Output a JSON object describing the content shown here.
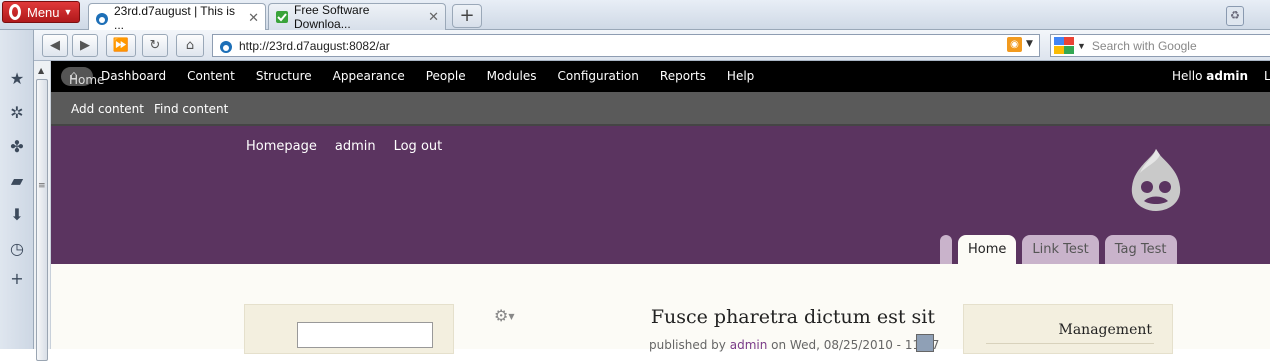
{
  "browser": {
    "menu_label": "Menu",
    "tabs": [
      {
        "title": "23rd.d7august | This is ...",
        "active": true
      },
      {
        "title": "Free Software Downloa...",
        "active": false
      }
    ],
    "url": "http://23rd.d7august:8082/ar",
    "search_placeholder": "Search with Google"
  },
  "toolbar": {
    "home_label": "Home",
    "menu": [
      "Dashboard",
      "Content",
      "Structure",
      "Appearance",
      "People",
      "Modules",
      "Configuration",
      "Reports",
      "Help"
    ],
    "hello_prefix": "Hello ",
    "user": "admin",
    "logout_partial": "L"
  },
  "shortcuts": [
    "Add content",
    "Find content"
  ],
  "site": {
    "secondary_nav": [
      "Homepage",
      "admin",
      "Log out"
    ],
    "primary_tabs": [
      "Home",
      "Link Test",
      "Tag Test"
    ]
  },
  "node": {
    "title": "Fusce pharetra dictum est sit",
    "submitted_prefix": "published by ",
    "author": "admin",
    "submitted_suffix": " on Wed, 08/25/2010 - 11:37"
  },
  "sidebar_right": {
    "block_title": "Management"
  },
  "colors": {
    "header": "#5b3460",
    "toolbar": "#000000",
    "shortcuts": "#5a5a5a",
    "content_bg": "#fcfbf6"
  }
}
